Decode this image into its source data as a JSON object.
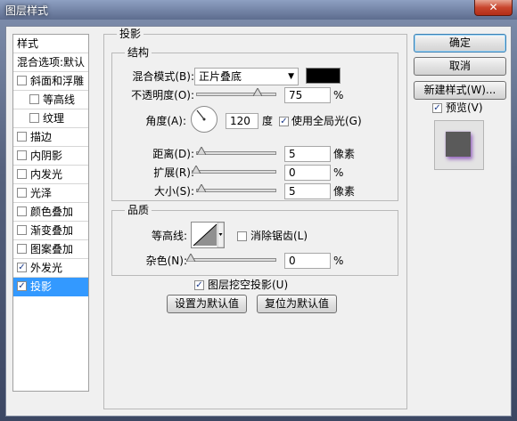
{
  "window": {
    "title": "图层样式",
    "close_icon": "close-icon"
  },
  "style_list": {
    "header": "样式",
    "blend_options": "混合选项:默认",
    "items": [
      {
        "label": "斜面和浮雕",
        "checked": false,
        "indent": false
      },
      {
        "label": "等高线",
        "checked": false,
        "indent": true
      },
      {
        "label": "纹理",
        "checked": false,
        "indent": true
      },
      {
        "label": "描边",
        "checked": false,
        "indent": false
      },
      {
        "label": "内阴影",
        "checked": false,
        "indent": false
      },
      {
        "label": "内发光",
        "checked": false,
        "indent": false
      },
      {
        "label": "光泽",
        "checked": false,
        "indent": false
      },
      {
        "label": "颜色叠加",
        "checked": false,
        "indent": false
      },
      {
        "label": "渐变叠加",
        "checked": false,
        "indent": false
      },
      {
        "label": "图案叠加",
        "checked": false,
        "indent": false
      },
      {
        "label": "外发光",
        "checked": true,
        "indent": false
      },
      {
        "label": "投影",
        "checked": true,
        "indent": false,
        "selected": true
      }
    ]
  },
  "drop_shadow": {
    "title": "投影",
    "structure": {
      "title": "结构",
      "blend_mode_label": "混合模式(B):",
      "blend_mode_value": "正片叠底",
      "blend_color": "#000000",
      "opacity_label": "不透明度(O):",
      "opacity_value": "75",
      "opacity_unit": "%",
      "angle_label": "角度(A):",
      "angle_value": "120",
      "angle_unit": "度",
      "global_light_label": "使用全局光(G)",
      "global_light_checked": true,
      "distance_label": "距离(D):",
      "distance_value": "5",
      "distance_unit": "像素",
      "spread_label": "扩展(R):",
      "spread_value": "0",
      "spread_unit": "%",
      "size_label": "大小(S):",
      "size_value": "5",
      "size_unit": "像素"
    },
    "quality": {
      "title": "品质",
      "contour_label": "等高线:",
      "anti_alias_label": "消除锯齿(L)",
      "anti_alias_checked": false,
      "noise_label": "杂色(N):",
      "noise_value": "0",
      "noise_unit": "%"
    },
    "knockout_label": "图层挖空投影(U)",
    "knockout_checked": true,
    "make_default_label": "设置为默认值",
    "reset_default_label": "复位为默认值"
  },
  "side_buttons": {
    "ok": "确定",
    "cancel": "取消",
    "new_style": "新建样式(W)...",
    "preview_label": "预览(V)",
    "preview_checked": true
  }
}
